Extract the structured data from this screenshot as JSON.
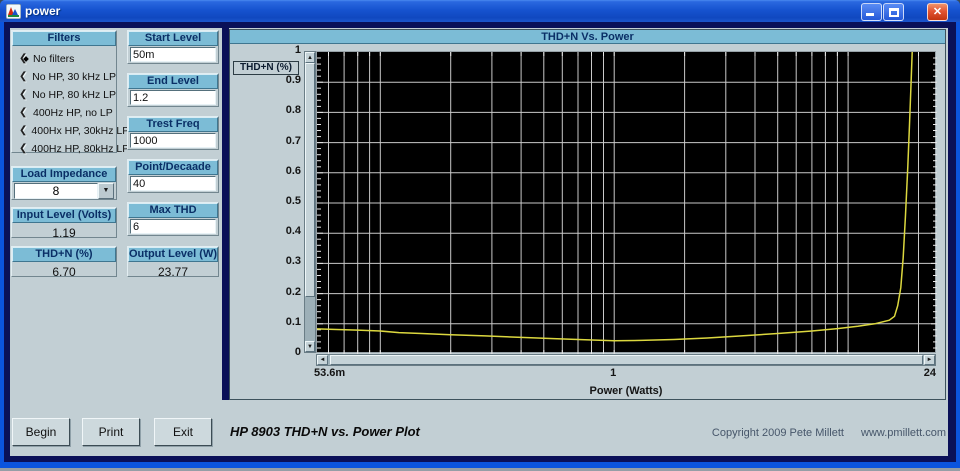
{
  "window": {
    "title": "power"
  },
  "filters": {
    "title": "Filters",
    "options": [
      {
        "label": "No filters",
        "selected": true
      },
      {
        "label": "No HP, 30 kHz LP",
        "selected": false
      },
      {
        "label": "No HP, 80 kHz LP",
        "selected": false
      },
      {
        "label": "400Hz HP, no LP",
        "selected": false
      },
      {
        "label": "400Hx HP, 30kHz LP",
        "selected": false
      },
      {
        "label": "400Hz HP, 80kHz LP",
        "selected": false
      }
    ]
  },
  "load_impedance": {
    "label": "Load Impedance",
    "value": "8"
  },
  "input_level": {
    "label": "Input Level (Volts)",
    "value": "1.19"
  },
  "thd_n": {
    "label": "THD+N (%)",
    "value": "6.70"
  },
  "start_level": {
    "label": "Start Level",
    "value": "50m"
  },
  "end_level": {
    "label": "End Level",
    "value": "1.2"
  },
  "test_freq": {
    "label": "Trest Freq",
    "value": "1000"
  },
  "points_decade": {
    "label": "Point/Decaade",
    "value": "40"
  },
  "max_thd": {
    "label": "Max THD",
    "value": "6"
  },
  "output_level": {
    "label": "Output Level (W)",
    "value": "23.77"
  },
  "buttons": {
    "begin": "Begin",
    "print": "Print",
    "exit": "Exit"
  },
  "footer": {
    "title": "HP 8903 THD+N vs. Power Plot",
    "copyright": "Copyright 2009 Pete Millett",
    "website": "www.pmillett.com"
  },
  "chart_data": {
    "type": "line",
    "title": "THD+N Vs. Power",
    "xlabel": "Power (Watts)",
    "ylabel": "THD+N (%)",
    "x_scale": "log",
    "xlim": [
      0.0536,
      24
    ],
    "ylim": [
      0,
      1
    ],
    "grid": true,
    "plot_bg": "#000000",
    "grid_color": "#c9c9c9",
    "xticks": [
      {
        "value": 0.0536,
        "label": "53.6m"
      },
      {
        "value": 1,
        "label": "1"
      },
      {
        "value": 24,
        "label": "24"
      }
    ],
    "yticks": [
      {
        "value": 1,
        "label": "1"
      },
      {
        "value": 0.9,
        "label": "0.9"
      },
      {
        "value": 0.8,
        "label": "0.8"
      },
      {
        "value": 0.7,
        "label": "0.7"
      },
      {
        "value": 0.6,
        "label": "0.6"
      },
      {
        "value": 0.5,
        "label": "0.5"
      },
      {
        "value": 0.4,
        "label": "0.4"
      },
      {
        "value": 0.3,
        "label": "0.3"
      },
      {
        "value": 0.2,
        "label": "0.2"
      },
      {
        "value": 0.1,
        "label": "0.1"
      },
      {
        "value": 0,
        "label": "0"
      }
    ],
    "x_gridlines": [
      0.06,
      0.07,
      0.08,
      0.09,
      0.1,
      0.2,
      0.3,
      0.4,
      0.5,
      0.6,
      0.7,
      0.8,
      0.9,
      1,
      2,
      3,
      4,
      5,
      6,
      7,
      8,
      9,
      10,
      20
    ],
    "y_gridlines": [
      0.1,
      0.2,
      0.3,
      0.4,
      0.5,
      0.6,
      0.7,
      0.8,
      0.9
    ],
    "series": [
      {
        "name": "THD+N",
        "color": "#dcd83f",
        "points": [
          [
            0.0536,
            0.083
          ],
          [
            0.065,
            0.081
          ],
          [
            0.08,
            0.079
          ],
          [
            0.1,
            0.076
          ],
          [
            0.12,
            0.071
          ],
          [
            0.15,
            0.068
          ],
          [
            0.2,
            0.064
          ],
          [
            0.28,
            0.06
          ],
          [
            0.4,
            0.055
          ],
          [
            0.55,
            0.051
          ],
          [
            0.75,
            0.047
          ],
          [
            1.0,
            0.044
          ],
          [
            1.3,
            0.045
          ],
          [
            1.8,
            0.048
          ],
          [
            2.5,
            0.053
          ],
          [
            3.5,
            0.06
          ],
          [
            5,
            0.068
          ],
          [
            7,
            0.076
          ],
          [
            9,
            0.084
          ],
          [
            11,
            0.092
          ],
          [
            13,
            0.1
          ],
          [
            15,
            0.112
          ],
          [
            15.8,
            0.125
          ],
          [
            16.3,
            0.16
          ],
          [
            16.8,
            0.22
          ],
          [
            17.2,
            0.32
          ],
          [
            17.6,
            0.46
          ],
          [
            18,
            0.62
          ],
          [
            18.3,
            0.76
          ],
          [
            18.6,
            0.9
          ],
          [
            18.8,
            1.0
          ]
        ]
      }
    ]
  }
}
